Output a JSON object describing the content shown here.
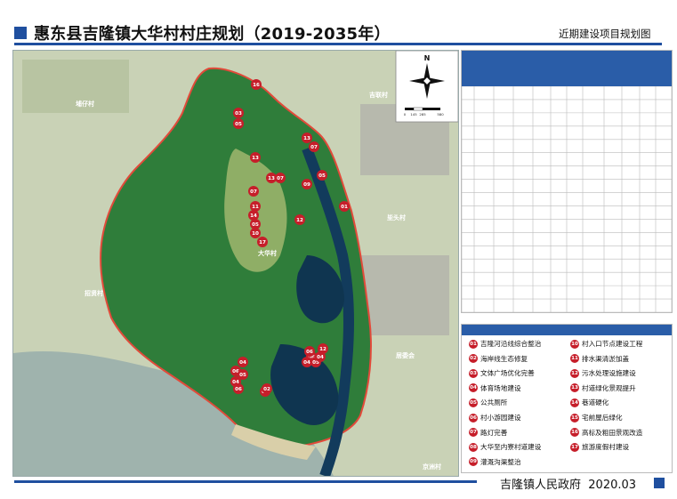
{
  "header": {
    "title": "惠东县吉隆镇大华村村庄规划（2019-2035年）",
    "map_subtitle": "近期建设项目规划图"
  },
  "footer": {
    "org": "吉隆镇人民政府",
    "date": "2020.03"
  },
  "map": {
    "compass_letter": "N",
    "scale_ticks": [
      "0",
      "145",
      "285",
      "580"
    ],
    "village_labels": [
      {
        "id": "puzai",
        "text": "埔仔村"
      },
      {
        "id": "jilian",
        "text": "吉联村"
      },
      {
        "id": "dahua",
        "text": "大华村"
      },
      {
        "id": "pitou",
        "text": "坒头村"
      },
      {
        "id": "zhaoxian",
        "text": "招贤村"
      },
      {
        "id": "jujiao",
        "text": "居委会"
      },
      {
        "id": "jingzhou",
        "text": "京洲村"
      }
    ],
    "project_markers": [
      "16",
      "03",
      "05",
      "13",
      "07",
      "13",
      "13",
      "07",
      "09",
      "05",
      "07",
      "11",
      "01",
      "14",
      "05",
      "10",
      "12",
      "17",
      "02",
      "06",
      "04",
      "05",
      "06",
      "04",
      "12",
      "06",
      "04",
      "05",
      "04",
      "06",
      "02"
    ]
  },
  "legend": {
    "items": [
      {
        "num": "01",
        "text": "吉隆河沿线综合整治"
      },
      {
        "num": "02",
        "text": "海岸线生态修复"
      },
      {
        "num": "03",
        "text": "文体广场优化完善"
      },
      {
        "num": "04",
        "text": "体育场地建设"
      },
      {
        "num": "05",
        "text": "公共厕所"
      },
      {
        "num": "06",
        "text": "村小游园建设"
      },
      {
        "num": "07",
        "text": "路灯完善"
      },
      {
        "num": "08",
        "text": "大华至内寮村道建设"
      },
      {
        "num": "09",
        "text": "灌溉沟渠整治"
      },
      {
        "num": "10",
        "text": "村入口节点建设工程"
      },
      {
        "num": "11",
        "text": "排水渠清淤加盖"
      },
      {
        "num": "12",
        "text": "污水处理设施建设"
      },
      {
        "num": "13",
        "text": "村道绿化景观提升"
      },
      {
        "num": "14",
        "text": "巷道硬化"
      },
      {
        "num": "15",
        "text": "宅前屋后绿化"
      },
      {
        "num": "16",
        "text": "高标及粗田景观改造"
      },
      {
        "num": "17",
        "text": "旅游度假村建设"
      }
    ]
  },
  "colors": {
    "brand_blue": "#1f4f9f",
    "marker_red": "#c61e2a",
    "boundary_red": "#e24a3a",
    "forest_green": "#2f7d3a"
  }
}
